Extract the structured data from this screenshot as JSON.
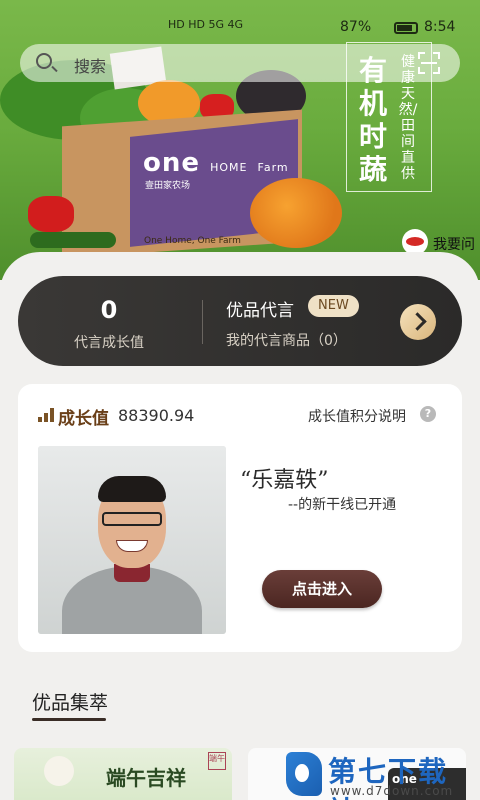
{
  "status_bar": {
    "left_indicators": "HD HD 5G 4G",
    "battery": "87%",
    "time": "8:54"
  },
  "search": {
    "placeholder": "搜索"
  },
  "hero": {
    "title": "有机时蔬",
    "subtitle": "健康天然/田间直供",
    "box_brand": "one",
    "box_brand_suffix": "HOME",
    "box_brand_sub": "Farm",
    "box_chinese": "壹田家农场",
    "box_slogan": "One Home, One Farm",
    "ask_label": "我要问"
  },
  "endorse": {
    "growth_value": "0",
    "growth_label": "代言成长值",
    "title": "优品代言",
    "new_tag": "NEW",
    "my_products": "我的代言商品（0）"
  },
  "growth_card": {
    "label": "成长值",
    "value": "88390.94",
    "help_text": "成长值积分说明",
    "help_icon": "?",
    "quote": "“乐嘉轶”",
    "quote_sub": "--的新干线已开通",
    "enter_button": "点击进入"
  },
  "section": {
    "title": "优品集萃"
  },
  "promos": [
    {
      "text": "端午吉祥",
      "stamp": "端午"
    },
    {
      "logo": "one"
    }
  ],
  "watermark": {
    "title": "第七下载站",
    "url": "www.d7down.com"
  },
  "colors": {
    "hero_green": "#6aac3e",
    "brown_accent": "#6a3f18",
    "dark_panel": "#2b2a29",
    "gold": "#d9b57c"
  }
}
